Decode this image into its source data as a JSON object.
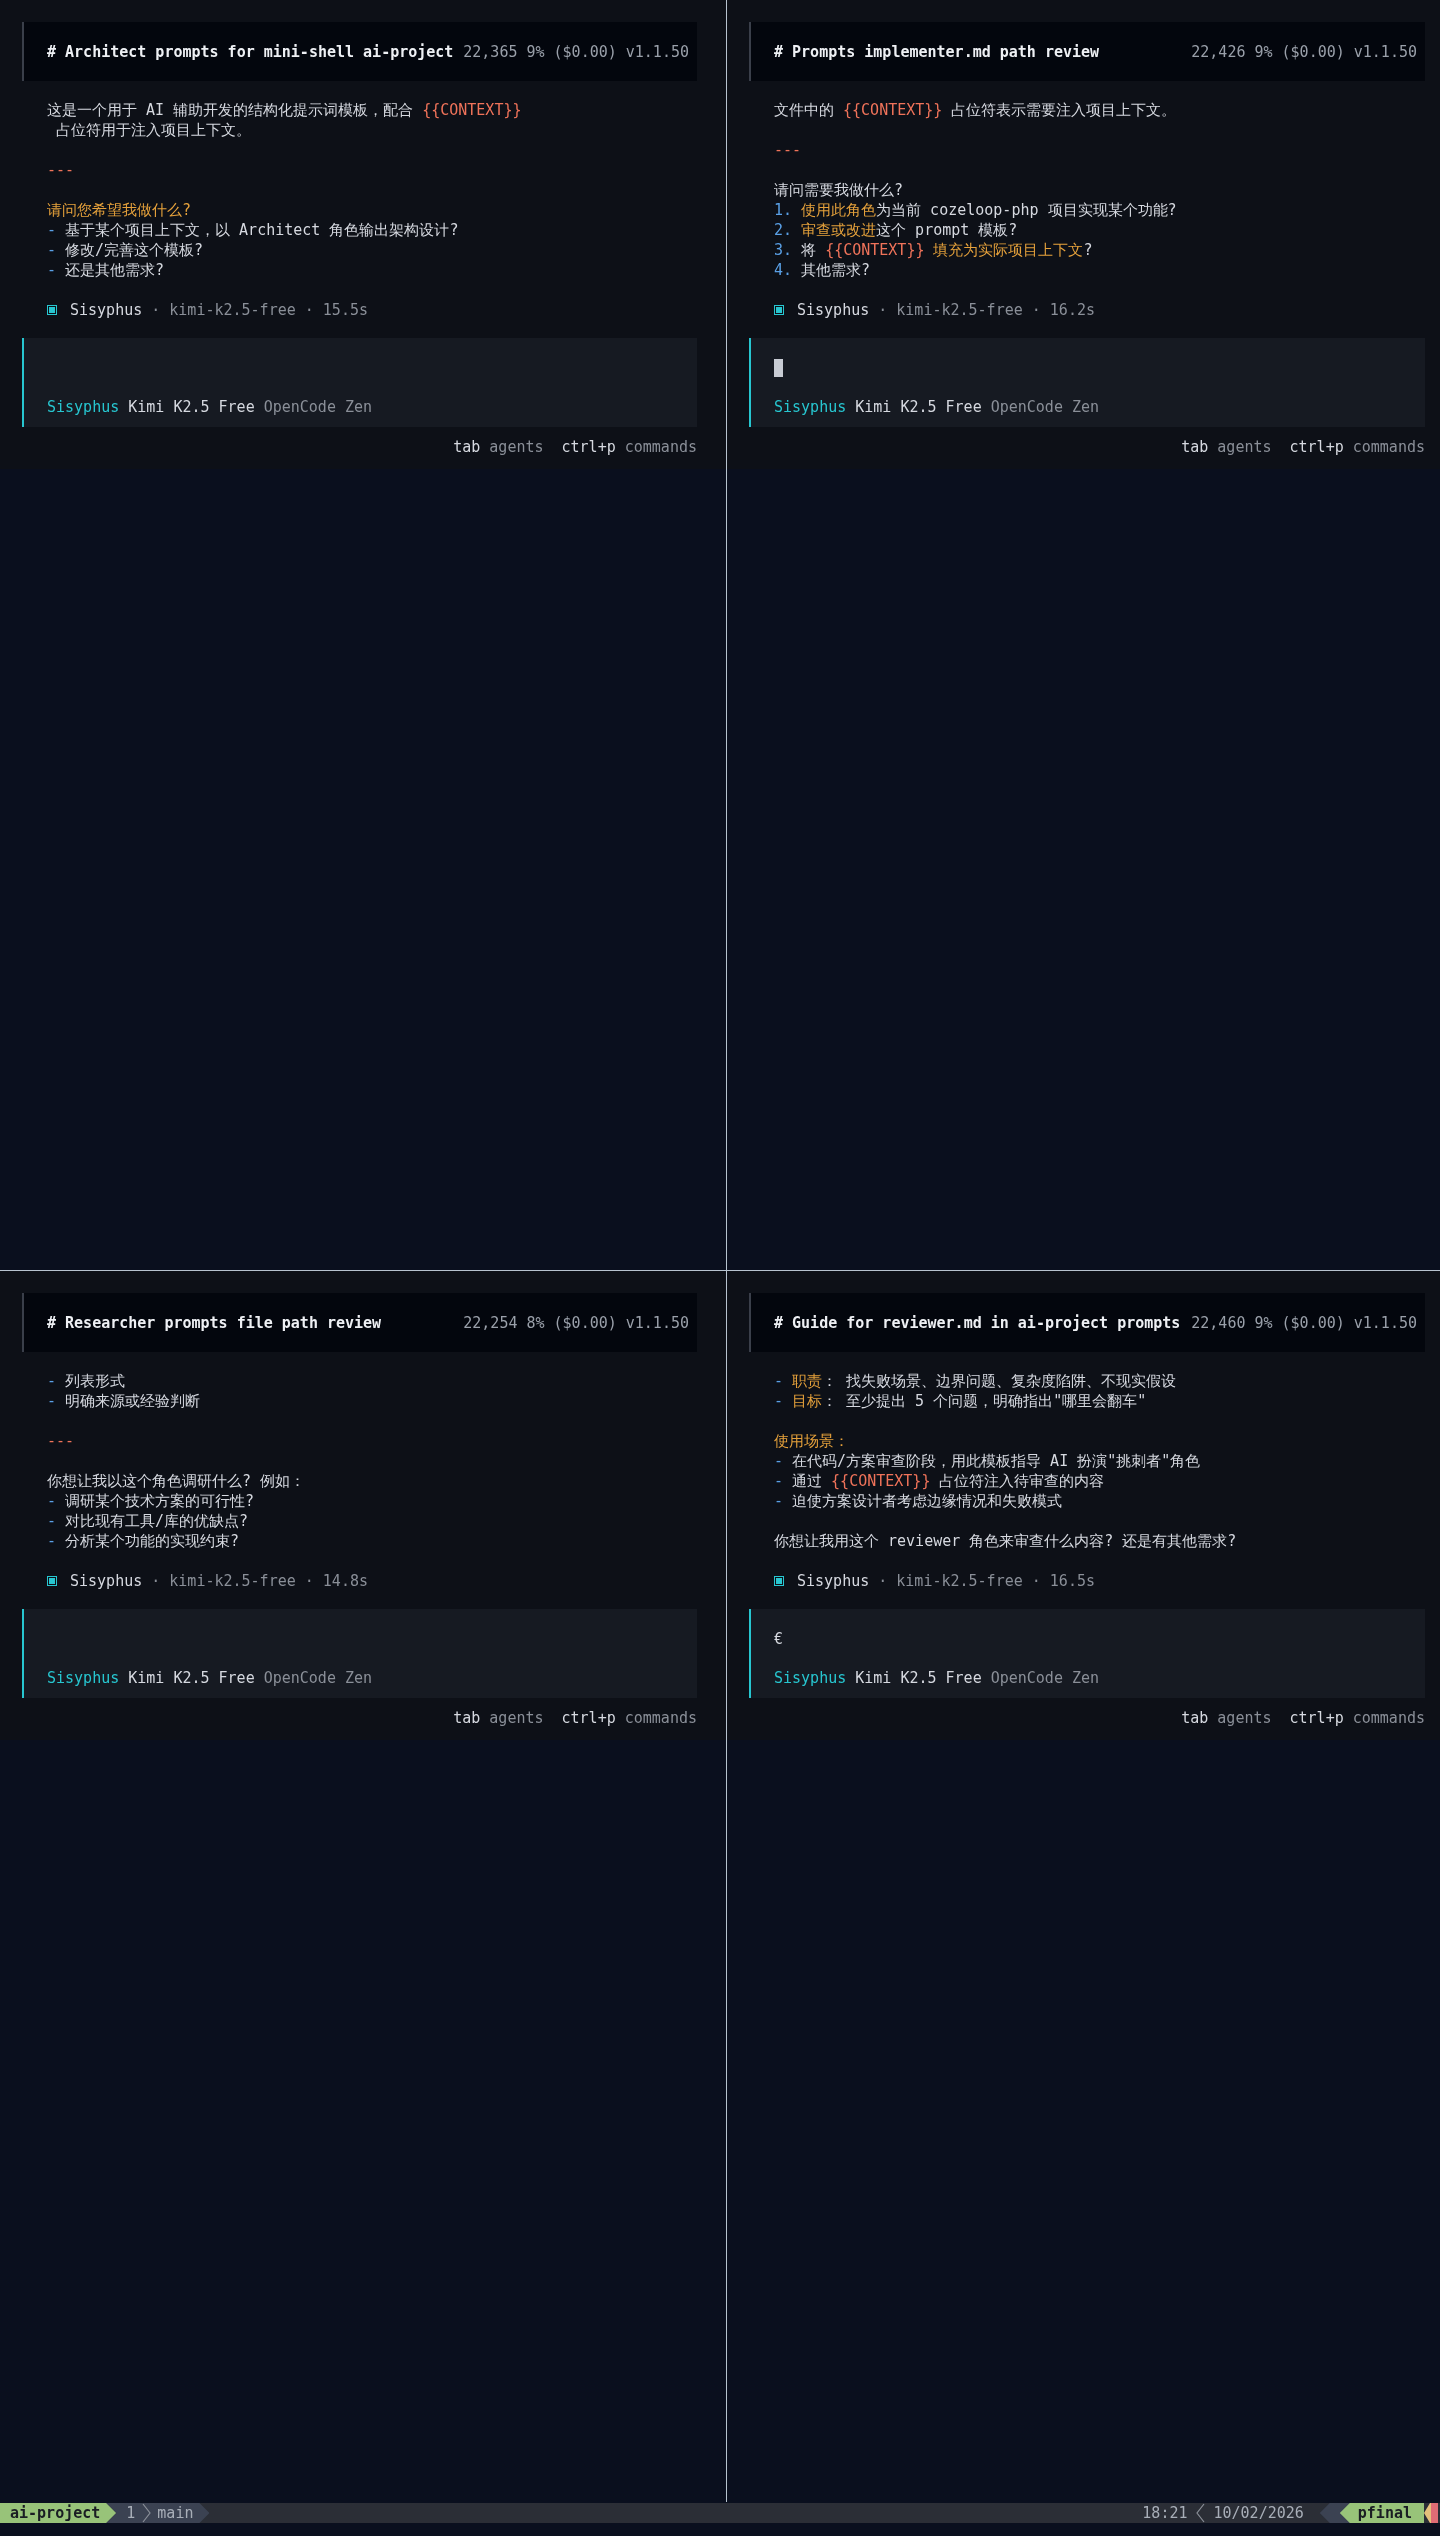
{
  "panes": [
    {
      "title": "# Architect prompts for mini-shell ai-project",
      "tokens": "22,365",
      "usage": "9% ($0.00)",
      "version": "v1.1.50",
      "blocks": [
        [
          [
            {
              "text": "这是一个用于 AI 辅助开发的结构化提示词模板，配合 ",
              "kind": "plain"
            },
            {
              "text": "{{CONTEXT}}",
              "kind": "placeholder"
            }
          ],
          [
            {
              "text": " 占位符用于注入项目上下文。",
              "kind": "plain"
            }
          ]
        ],
        [
          [
            {
              "text": "---",
              "kind": "rule"
            }
          ]
        ],
        [
          [
            {
              "text": "请问您希望我做什么?",
              "kind": "heading"
            }
          ],
          [
            {
              "text": "- ",
              "kind": "marker"
            },
            {
              "text": "基于某个项目上下文，以 Architect 角色输出架构设计?",
              "kind": "plain"
            }
          ],
          [
            {
              "text": "- ",
              "kind": "marker"
            },
            {
              "text": "修改/完善这个模板?",
              "kind": "plain"
            }
          ],
          [
            {
              "text": "- ",
              "kind": "marker"
            },
            {
              "text": "还是其他需求?",
              "kind": "plain"
            }
          ]
        ]
      ],
      "agent_line": {
        "agent": "Sisyphus",
        "details": "· kimi-k2.5-free · 15.5s"
      },
      "input": {
        "cursor": false
      },
      "prompt_status": {
        "agent": "Sisyphus",
        "model": "Kimi K2.5 Free",
        "provider": "OpenCode Zen"
      },
      "hints": [
        {
          "key": "tab",
          "label": "agents"
        },
        {
          "key": "ctrl+p",
          "label": "commands"
        }
      ]
    },
    {
      "title": "# Prompts implementer.md path review",
      "tokens": "22,426",
      "usage": "9% ($0.00)",
      "version": "v1.1.50",
      "blocks": [
        [
          [
            {
              "text": "文件中的 ",
              "kind": "plain"
            },
            {
              "text": "{{CONTEXT}}",
              "kind": "placeholder"
            },
            {
              "text": " 占位符表示需要注入项目上下文。",
              "kind": "plain"
            }
          ]
        ],
        [
          [
            {
              "text": "---",
              "kind": "rule"
            }
          ]
        ],
        [
          [
            {
              "text": "请问需要我做什么?",
              "kind": "plain"
            }
          ],
          [
            {
              "text": "1. ",
              "kind": "marker"
            },
            {
              "text": "使用此角色",
              "kind": "heading"
            },
            {
              "text": "为当前 cozeloop-php 项目实现某个功能?",
              "kind": "plain"
            }
          ],
          [
            {
              "text": "2. ",
              "kind": "marker"
            },
            {
              "text": "审查或改进",
              "kind": "heading"
            },
            {
              "text": "这个 prompt 模板?",
              "kind": "plain"
            }
          ],
          [
            {
              "text": "3. ",
              "kind": "marker"
            },
            {
              "text": "将 ",
              "kind": "plain"
            },
            {
              "text": "{{CONTEXT}}",
              "kind": "placeholder"
            },
            {
              "text": " 填充为实际项目上下文",
              "kind": "heading"
            },
            {
              "text": "?",
              "kind": "plain"
            }
          ],
          [
            {
              "text": "4. ",
              "kind": "marker"
            },
            {
              "text": "其他需求?",
              "kind": "plain"
            }
          ]
        ]
      ],
      "agent_line": {
        "agent": "Sisyphus",
        "details": "· kimi-k2.5-free · 16.2s"
      },
      "input": {
        "cursor": true
      },
      "prompt_status": {
        "agent": "Sisyphus",
        "model": "Kimi K2.5 Free",
        "provider": "OpenCode Zen"
      },
      "hints": [
        {
          "key": "tab",
          "label": "agents"
        },
        {
          "key": "ctrl+p",
          "label": "commands"
        }
      ]
    },
    {
      "title": "# Researcher prompts file path review",
      "tokens": "22,254",
      "usage": "8% ($0.00)",
      "version": "v1.1.50",
      "blocks": [
        [
          [
            {
              "text": "- ",
              "kind": "marker"
            },
            {
              "text": "列表形式",
              "kind": "plain"
            }
          ],
          [
            {
              "text": "- ",
              "kind": "marker"
            },
            {
              "text": "明确来源或经验判断",
              "kind": "plain"
            }
          ]
        ],
        [
          [
            {
              "text": "---",
              "kind": "rule"
            }
          ]
        ],
        [
          [
            {
              "text": "你想让我以这个角色调研什么? 例如：",
              "kind": "plain"
            }
          ],
          [
            {
              "text": "- ",
              "kind": "marker"
            },
            {
              "text": "调研某个技术方案的可行性?",
              "kind": "plain"
            }
          ],
          [
            {
              "text": "- ",
              "kind": "marker"
            },
            {
              "text": "对比现有工具/库的优缺点?",
              "kind": "plain"
            }
          ],
          [
            {
              "text": "- ",
              "kind": "marker"
            },
            {
              "text": "分析某个功能的实现约束?",
              "kind": "plain"
            }
          ]
        ]
      ],
      "agent_line": {
        "agent": "Sisyphus",
        "details": "· kimi-k2.5-free · 14.8s"
      },
      "input": {
        "cursor": false
      },
      "prompt_status": {
        "agent": "Sisyphus",
        "model": "Kimi K2.5 Free",
        "provider": "OpenCode Zen"
      },
      "hints": [
        {
          "key": "tab",
          "label": "agents"
        },
        {
          "key": "ctrl+p",
          "label": "commands"
        }
      ]
    },
    {
      "title": "# Guide for reviewer.md in ai-project prompts",
      "tokens": "22,460",
      "usage": "9% ($0.00)",
      "version": "v1.1.50",
      "blocks": [
        [
          [
            {
              "text": "- ",
              "kind": "marker"
            },
            {
              "text": "职责",
              "kind": "heading"
            },
            {
              "text": "： 找失败场景、边界问题、复杂度陷阱、不现实假设",
              "kind": "plain"
            }
          ],
          [
            {
              "text": "- ",
              "kind": "marker"
            },
            {
              "text": "目标",
              "kind": "heading"
            },
            {
              "text": "： 至少提出 5 个问题，明确指出\"哪里会翻车\"",
              "kind": "plain"
            }
          ]
        ],
        [
          [
            {
              "text": "使用场景：",
              "kind": "heading"
            }
          ],
          [
            {
              "text": "- ",
              "kind": "marker"
            },
            {
              "text": "在代码/方案审查阶段，用此模板指导 AI 扮演\"挑刺者\"角色",
              "kind": "plain"
            }
          ],
          [
            {
              "text": "- ",
              "kind": "marker"
            },
            {
              "text": "通过 ",
              "kind": "plain"
            },
            {
              "text": "{{CONTEXT}}",
              "kind": "placeholder"
            },
            {
              "text": " 占位符注入待审查的内容",
              "kind": "plain"
            }
          ],
          [
            {
              "text": "- ",
              "kind": "marker"
            },
            {
              "text": "迫使方案设计者考虑边缘情况和失败模式",
              "kind": "plain"
            }
          ]
        ],
        [
          [
            {
              "text": "你想让我用这个 reviewer 角色来审查什么内容? 还是有其他需求?",
              "kind": "plain"
            }
          ]
        ]
      ],
      "agent_line": {
        "agent": "Sisyphus",
        "details": "· kimi-k2.5-free · 16.5s"
      },
      "input": {
        "cursor": false,
        "value": "€"
      },
      "prompt_status": {
        "agent": "Sisyphus",
        "model": "Kimi K2.5 Free",
        "provider": "OpenCode Zen"
      },
      "hints": [
        {
          "key": "tab",
          "label": "agents"
        },
        {
          "key": "ctrl+p",
          "label": "commands"
        }
      ]
    }
  ],
  "status_bar": {
    "session": "ai-project",
    "window_index": "1",
    "window_name": "main",
    "time": "18:21",
    "date": "10/02/2026",
    "host": "pfinal"
  }
}
